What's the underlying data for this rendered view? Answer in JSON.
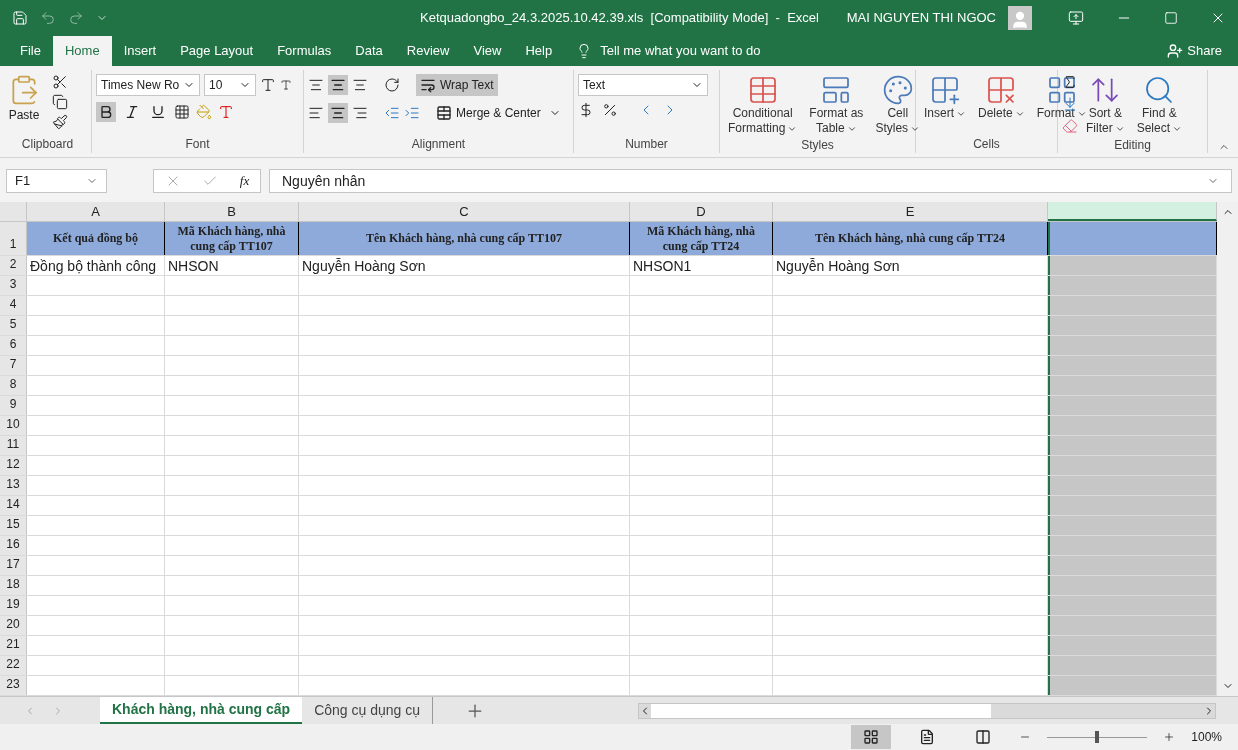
{
  "window": {
    "title": "Ketquadongbo_24.3.2025.10.42.39.xls  [Compatibility Mode]  -  Excel",
    "user": "MAI NGUYEN THI NGOC"
  },
  "tabs": [
    {
      "label": "File",
      "selected": false
    },
    {
      "label": "Home",
      "selected": true
    },
    {
      "label": "Insert",
      "selected": false
    },
    {
      "label": "Page Layout",
      "selected": false
    },
    {
      "label": "Formulas",
      "selected": false
    },
    {
      "label": "Data",
      "selected": false
    },
    {
      "label": "Review",
      "selected": false
    },
    {
      "label": "View",
      "selected": false
    },
    {
      "label": "Help",
      "selected": false
    }
  ],
  "tell_me": "Tell me what you want to do",
  "share": "Share",
  "ribbon": {
    "clipboard": {
      "label": "Clipboard",
      "paste": "Paste"
    },
    "font": {
      "label": "Font",
      "name": "Times New Ro",
      "size": "10",
      "bold": true,
      "italic": false,
      "underline": false
    },
    "alignment": {
      "label": "Alignment",
      "wrap_text": {
        "label": "Wrap Text",
        "selected": true
      },
      "merge": "Merge & Center",
      "middle_selected": true,
      "center_selected": true
    },
    "number": {
      "label": "Number",
      "format": "Text"
    },
    "styles": {
      "label": "Styles",
      "buttons": [
        {
          "kind": "conditional",
          "lines": [
            "Conditional",
            "Formatting"
          ]
        },
        {
          "kind": "table",
          "lines": [
            "Format as",
            "Table"
          ]
        },
        {
          "kind": "cellstyles",
          "lines": [
            "Cell",
            "Styles"
          ]
        }
      ]
    },
    "cells": {
      "label": "Cells",
      "buttons": [
        {
          "kind": "insert",
          "label": "Insert"
        },
        {
          "kind": "delete",
          "label": "Delete"
        },
        {
          "kind": "format",
          "label": "Format"
        }
      ]
    },
    "editing": {
      "label": "Editing",
      "buttons": [
        {
          "kind": "sort",
          "lines": [
            "Sort &",
            "Filter"
          ]
        },
        {
          "kind": "find",
          "lines": [
            "Find &",
            "Select"
          ]
        }
      ]
    }
  },
  "formula_bar": {
    "name_box": "F1",
    "function_label": "fx",
    "content": "Nguyên nhân"
  },
  "sheet": {
    "columns": [
      {
        "letter": "A",
        "selected": false
      },
      {
        "letter": "B",
        "selected": false
      },
      {
        "letter": "C",
        "selected": false
      },
      {
        "letter": "D",
        "selected": false
      },
      {
        "letter": "E",
        "selected": false
      },
      {
        "selected": true
      }
    ],
    "rows": [
      {
        "number": "1",
        "kind": "header",
        "cells": [
          "Kết quả đồng bộ",
          "Mã Khách hàng, nhà cung cấp TT107",
          "Tên Khách hàng, nhà cung cấp TT107",
          "Mã Khách hàng, nhà cung cấp TT24",
          "Tên Khách hàng, nhà cung cấp TT24"
        ]
      },
      {
        "number": "2",
        "kind": "data",
        "cells": [
          "Đồng bộ thành công",
          "NHSON",
          "Nguyễn Hoàng Sơn",
          "NHSON1",
          "Nguyễn Hoàng Sơn"
        ]
      },
      {
        "number": "3",
        "kind": "data",
        "cells": []
      },
      {
        "number": "4",
        "kind": "data",
        "cells": []
      },
      {
        "number": "5",
        "kind": "data",
        "cells": []
      },
      {
        "number": "6",
        "kind": "data",
        "cells": []
      },
      {
        "number": "7",
        "kind": "data",
        "cells": []
      },
      {
        "number": "8",
        "kind": "data",
        "cells": []
      },
      {
        "number": "9",
        "kind": "data",
        "cells": []
      },
      {
        "number": "10",
        "kind": "data",
        "cells": []
      },
      {
        "number": "11",
        "kind": "data",
        "cells": []
      },
      {
        "number": "12",
        "kind": "data",
        "cells": []
      },
      {
        "number": "13",
        "kind": "data",
        "cells": []
      },
      {
        "number": "14",
        "kind": "data",
        "cells": []
      },
      {
        "number": "15",
        "kind": "data",
        "cells": []
      },
      {
        "number": "16",
        "kind": "data",
        "cells": []
      },
      {
        "number": "17",
        "kind": "data",
        "cells": []
      },
      {
        "number": "18",
        "kind": "data",
        "cells": []
      },
      {
        "number": "19",
        "kind": "data",
        "cells": []
      },
      {
        "number": "20",
        "kind": "data",
        "cells": []
      },
      {
        "number": "21",
        "kind": "data",
        "cells": []
      },
      {
        "number": "22",
        "kind": "data",
        "cells": []
      },
      {
        "number": "23",
        "kind": "data",
        "cells": []
      }
    ]
  },
  "sheet_tabs": [
    {
      "label": "Khách hàng, nhà cung cấp",
      "selected": true
    },
    {
      "label": "Công cụ dụng cụ",
      "selected": false
    }
  ],
  "status_bar": {
    "views": [
      {
        "kind": "normal",
        "selected": true
      },
      {
        "kind": "layout",
        "selected": false
      },
      {
        "kind": "pagebreak",
        "selected": false
      }
    ],
    "zoom": {
      "level": 0.5,
      "label": "100%"
    }
  }
}
